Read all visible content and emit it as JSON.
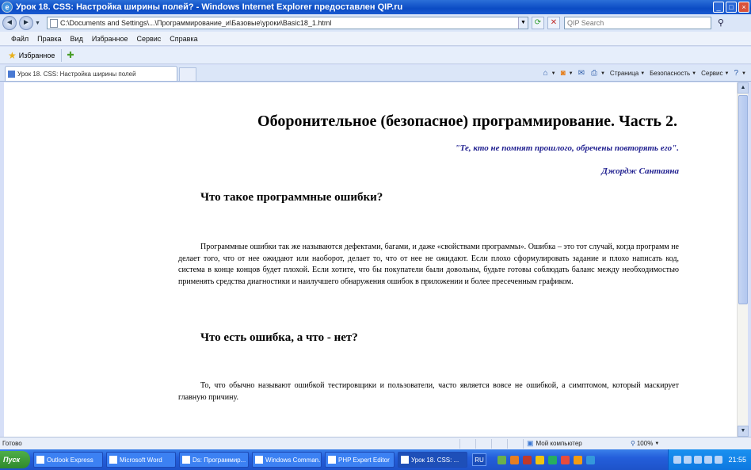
{
  "window": {
    "title": "Урок 18. CSS: Настройка ширины полей? - Windows Internet Explorer предоставлен QIP.ru",
    "controls": [
      "_",
      "□",
      "×"
    ]
  },
  "address_bar": {
    "url": "C:\\Documents and Settings\\...\\Программирование_и\\Базовые\\уроки\\Basic18_1.html",
    "search_placeholder": "QIP Search",
    "back_glyph": "◄",
    "forward_glyph": "►"
  },
  "menu": [
    "Файл",
    "Правка",
    "Вид",
    "Избранное",
    "Сервис",
    "Справка"
  ],
  "favorites_bar": {
    "label": "Избранное"
  },
  "tab": {
    "label": "Урок 18. CSS: Настройка ширины полей"
  },
  "command_bar": {
    "page": "Страница",
    "safety": "Безопасность",
    "tools": "Сервис",
    "help": "?"
  },
  "document": {
    "title": "Оборонительное (безопасное) программирование. Часть 2.",
    "epigraph": "\"Те, кто не помнят прошлого, обречены повторять его\".",
    "epigraph_author": "Джордж Сантаяна",
    "section1_heading": "Что такое программные ошибки?",
    "section1_text": "Программные ошибки так же называются дефектами, багами, и даже «свойствами программы». Ошибка – это тот случай, когда программ не делает того, что от нее ожидают или наоборот, делает то, что от нее не ожидают. Если плохо сформулировать задание и плохо написать код, система в конце концов будет плохой. Если хотите, что бы покупатели были довольны, будьте готовы соблюдать баланс между необходимостью применять средства диагностики и наилучшего обнаружения ошибок в приложении и более пресеченным графиком.",
    "section2_heading": "Что есть ошибка, а что - нет?",
    "section2_text": "То, что обычно называют ошибкой тестировщики и пользователи, часто является вовсе не ошибкой, а симптомом, который маскирует главную причину."
  },
  "status_bar": {
    "text": "Готово",
    "zone": "Мой компьютер",
    "zoom": "100%"
  },
  "taskbar": {
    "start": "Пуск",
    "tasks": [
      "Outlook Express",
      "Microsoft Word",
      "Ds: Программир...",
      "Windows Comman...",
      "PHP Expert Editor",
      "Урок 18. CSS: ..."
    ],
    "language": "RU",
    "clock": "21:55"
  },
  "colors": {
    "epigraph": "#1f1f8f",
    "titlebar": "#0b4bc4",
    "taskbar": "#245edb"
  }
}
